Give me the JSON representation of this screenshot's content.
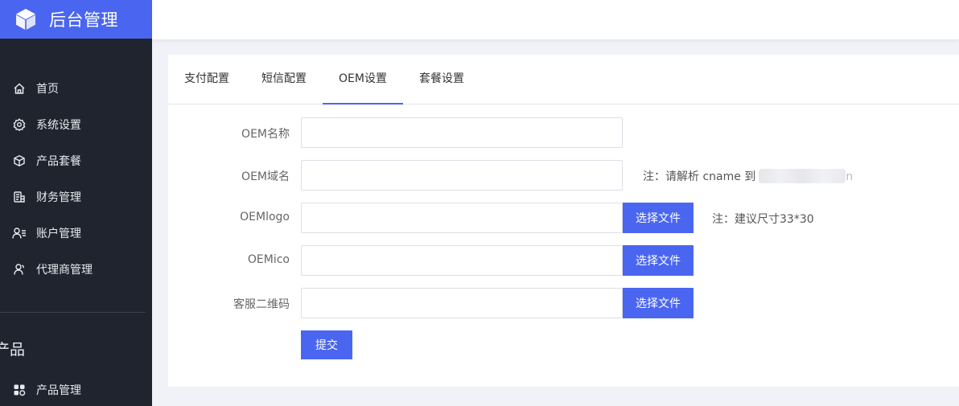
{
  "brand": {
    "title": "后台管理",
    "icon": "cube-icon"
  },
  "sidebar": {
    "items": [
      {
        "label": "首页",
        "icon": "home-icon"
      },
      {
        "label": "系统设置",
        "icon": "gear-icon"
      },
      {
        "label": "产品套餐",
        "icon": "box-icon"
      },
      {
        "label": "财务管理",
        "icon": "ledger-icon"
      },
      {
        "label": "账户管理",
        "icon": "user-list-icon"
      },
      {
        "label": "代理商管理",
        "icon": "user-icon"
      }
    ],
    "section_title": "产品",
    "section_items": [
      {
        "label": "产品管理",
        "icon": "grid-apps-icon"
      }
    ]
  },
  "tabs": [
    {
      "label": "支付配置"
    },
    {
      "label": "短信配置"
    },
    {
      "label": "OEM设置",
      "active": true
    },
    {
      "label": "套餐设置"
    }
  ],
  "form": {
    "oem_name": {
      "label": "OEM名称",
      "value": "",
      "placeholder": ""
    },
    "oem_domain": {
      "label": "OEM域名",
      "value": "",
      "placeholder": "",
      "note_prefix": "注：请解析 cname 到",
      "note_suffix": "n"
    },
    "oem_logo": {
      "label": "OEMlogo",
      "value": "",
      "button": "选择文件",
      "note": "注：建议尺寸33*30"
    },
    "oem_ico": {
      "label": "OEMico",
      "value": "",
      "button": "选择文件"
    },
    "qr_code": {
      "label": "客服二维码",
      "value": "",
      "button": "选择文件"
    },
    "submit": "提交"
  },
  "colors": {
    "accent": "#4a66f0",
    "sidebar_bg": "#20242f",
    "page_bg": "#f0f2f7"
  }
}
